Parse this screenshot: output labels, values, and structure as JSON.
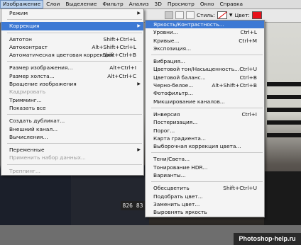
{
  "menubar": {
    "items": [
      "Изображение",
      "Слои",
      "Выделение",
      "Фильтр",
      "Анализ",
      "3D",
      "Просмотр",
      "Окно",
      "Справка"
    ]
  },
  "options": {
    "style_label": "Стиль:",
    "color_label": "Цвет:",
    "color": "#e8101a"
  },
  "image_menu": [
    {
      "label": "Режим",
      "arrow": true
    },
    {
      "sep": true
    },
    {
      "label": "Коррекция",
      "arrow": true,
      "hl": true
    },
    {
      "sep": true
    },
    {
      "label": "Автотон",
      "sc": "Shift+Ctrl+L"
    },
    {
      "label": "Автоконтраст",
      "sc": "Alt+Shift+Ctrl+L"
    },
    {
      "label": "Автоматическая цветовая коррекция",
      "sc": "Shift+Ctrl+B"
    },
    {
      "sep": true
    },
    {
      "label": "Размер изображения...",
      "sc": "Alt+Ctrl+I"
    },
    {
      "label": "Размер холста...",
      "sc": "Alt+Ctrl+C"
    },
    {
      "label": "Вращение изображения",
      "arrow": true
    },
    {
      "label": "Кадрировать",
      "dis": true
    },
    {
      "label": "Тримминг..."
    },
    {
      "label": "Показать все"
    },
    {
      "sep": true
    },
    {
      "label": "Создать дубликат..."
    },
    {
      "label": "Внешний канал..."
    },
    {
      "label": "Вычисления..."
    },
    {
      "sep": true
    },
    {
      "label": "Переменные",
      "arrow": true
    },
    {
      "label": "Применить набор данных...",
      "dis": true
    },
    {
      "sep": true
    },
    {
      "label": "Треппинг...",
      "dis": true
    }
  ],
  "adjust_menu": [
    {
      "label": "Яркость/Контрастность...",
      "hl": true
    },
    {
      "label": "Уровни...",
      "sc": "Ctrl+L"
    },
    {
      "label": "Кривые...",
      "sc": "Ctrl+M"
    },
    {
      "label": "Экспозиция..."
    },
    {
      "sep": true
    },
    {
      "label": "Вибрация..."
    },
    {
      "label": "Цветовой тон/Насыщенность...",
      "sc": "Ctrl+U"
    },
    {
      "label": "Цветовой баланс...",
      "sc": "Ctrl+B"
    },
    {
      "label": "Черно-белое...",
      "sc": "Alt+Shift+Ctrl+B"
    },
    {
      "label": "Фотофильтр..."
    },
    {
      "label": "Микширование каналов..."
    },
    {
      "sep": true
    },
    {
      "label": "Инверсия",
      "sc": "Ctrl+I"
    },
    {
      "label": "Постеризация..."
    },
    {
      "label": "Порог..."
    },
    {
      "label": "Карта градиента..."
    },
    {
      "label": "Выборочная коррекция цвета..."
    },
    {
      "sep": true
    },
    {
      "label": "Тени/Света..."
    },
    {
      "label": "Тонирование HDR..."
    },
    {
      "label": "Варианты..."
    },
    {
      "sep": true
    },
    {
      "label": "Обесцветить",
      "sc": "Shift+Ctrl+U"
    },
    {
      "label": "Подобрать цвет..."
    },
    {
      "label": "Заменить цвет..."
    },
    {
      "label": "Выровнять яркость"
    }
  ],
  "plate_number": "826 83",
  "watermark": "Photoshop-help.ru"
}
